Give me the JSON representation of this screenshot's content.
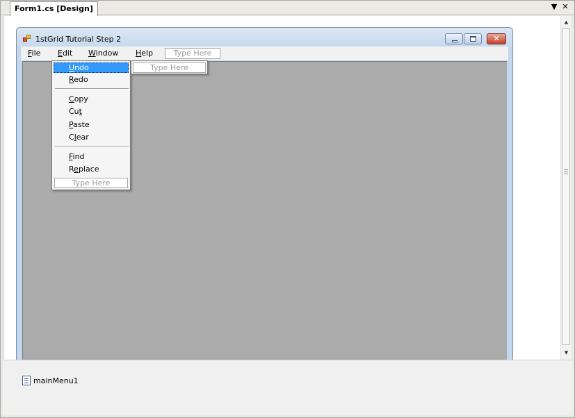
{
  "document_tab": {
    "title": "Form1.cs [Design]"
  },
  "tab_controls": {
    "dropdown": "▼",
    "close": "✕"
  },
  "form": {
    "title": "1stGrid Tutorial Step 2",
    "caption_buttons": {
      "minimize": "minimize-icon",
      "maximize": "maximize-icon",
      "close": "close-icon",
      "close_glyph": "✕"
    }
  },
  "menubar": {
    "items": [
      {
        "pre": "",
        "mnemonic": "F",
        "post": "ile"
      },
      {
        "pre": "",
        "mnemonic": "E",
        "post": "dit"
      },
      {
        "pre": "",
        "mnemonic": "W",
        "post": "indow"
      },
      {
        "pre": "",
        "mnemonic": "H",
        "post": "elp"
      }
    ],
    "type_here": "Type Here"
  },
  "edit_menu": {
    "items": [
      {
        "pre": "",
        "mnemonic": "U",
        "post": "ndo",
        "selected": true
      },
      {
        "pre": "",
        "mnemonic": "R",
        "post": "edo"
      },
      {
        "pre": "",
        "mnemonic": "C",
        "post": "opy"
      },
      {
        "pre": "Cu",
        "mnemonic": "t",
        "post": ""
      },
      {
        "pre": "",
        "mnemonic": "P",
        "post": "aste"
      },
      {
        "pre": "C",
        "mnemonic": "l",
        "post": "ear"
      },
      {
        "pre": "",
        "mnemonic": "F",
        "post": "ind"
      },
      {
        "pre": "R",
        "mnemonic": "e",
        "post": "place"
      }
    ],
    "type_here": "Type Here",
    "submenu_type_here": "Type Here"
  },
  "tray": {
    "component": "mainMenu1"
  },
  "colors": {
    "menu_highlight": "#3399ff",
    "client_area": "#ababab",
    "window_frame": "#c3d7ee"
  }
}
